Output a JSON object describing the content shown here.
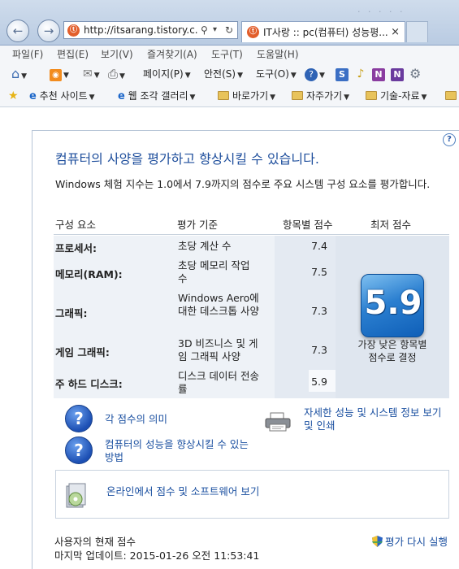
{
  "browser": {
    "url": "http://itsarang.tistory.c...",
    "tab_title": "IT사랑 :: pc(컴퓨터) 성능평...",
    "tab_close": "×",
    "search_glyph": "⚲",
    "dropdown_glyph": "▾",
    "refresh_glyph": "↻",
    "back_glyph": "←",
    "forward_glyph": "→"
  },
  "menu": [
    "파일(F)",
    "편집(E)",
    "보기(V)",
    "즐겨찾기(A)",
    "도구(T)",
    "도움말(H)"
  ],
  "command_bar": {
    "page": "페이지(P)",
    "safety": "안전(S)",
    "tools": "도구(O)"
  },
  "favorites_bar": {
    "suggested": "추천 사이트",
    "web_slice": "웹 조각 갤러리",
    "shortcuts": "바로가기",
    "frequent": "자주가기",
    "tech": "기술-자료"
  },
  "wei": {
    "heading": "컴퓨터의 사양을 평가하고 향상시킬 수 있습니다.",
    "subtitle": "Windows 체험 지수는 1.0에서 7.9까지의 점수로 주요 시스템 구성 요소를 평가합니다.",
    "columns": [
      "구성 요소",
      "평가 기준",
      "항목별 점수",
      "최저 점수"
    ],
    "rows": [
      {
        "component": "프로세서:",
        "criteria": "초당 계산 수",
        "score": "7.4"
      },
      {
        "component": "메모리(RAM):",
        "criteria": "초당 메모리 작업 수",
        "score": "7.5"
      },
      {
        "component": "그래픽:",
        "criteria": "Windows Aero에 대한 데스크톱 사양",
        "score": "7.3"
      },
      {
        "component": "게임 그래픽:",
        "criteria": "3D 비즈니스 및 게임 그래픽 사양",
        "score": "7.3"
      },
      {
        "component": "주 하드 디스크:",
        "criteria": "디스크 데이터 전송률",
        "score": "5.9"
      }
    ],
    "base_score": "5.9",
    "base_caption": "가장 낮은 항목별 점수로 결정",
    "links": {
      "meaning": "각 점수의 의미",
      "improve": "컴퓨터의 성능을 향상시킬 수 있는 방법",
      "details": "자세한 성능 및 시스템 정보 보기 및 인쇄",
      "online": "온라인에서 점수 및 소프트웨어 보기"
    },
    "footer": {
      "current": "사용자의 현재 점수",
      "last_update": "마지막 업데이트: 2015-01-26 오전 11:53:41",
      "rerun": "평가 다시 실행"
    }
  },
  "colors": {
    "heading": "#1e4e9c",
    "link": "#1a4fa0",
    "badge": "#2b7fd0"
  }
}
